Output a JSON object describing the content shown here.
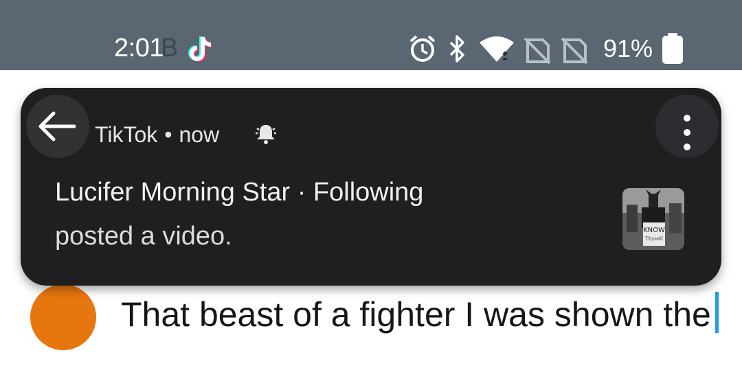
{
  "status_bar": {
    "time": "2:01",
    "time_ghost": "B",
    "battery_percent": "91%",
    "icons": [
      "tiktok-icon",
      "alarm-icon",
      "bluetooth-icon",
      "wifi-icon",
      "no-sim-icon",
      "no-sim-icon",
      "battery-icon"
    ]
  },
  "notification": {
    "app_name": "TikTok",
    "separator": "•",
    "time": "now",
    "title": "Lucifer Morning Star · Following",
    "body": "posted a video.",
    "thumbnail_text": "KNOW Thyself",
    "icons": [
      "back-arrow-icon",
      "bell-icon",
      "more-vertical-icon"
    ]
  },
  "composer": {
    "text": "That beast of a fighter I was shown the"
  },
  "colors": {
    "status_bar_bg": "#5a6672",
    "notification_bg": "#1f1f21",
    "caret": "#1d9bf0",
    "avatar": "#e8760e"
  }
}
